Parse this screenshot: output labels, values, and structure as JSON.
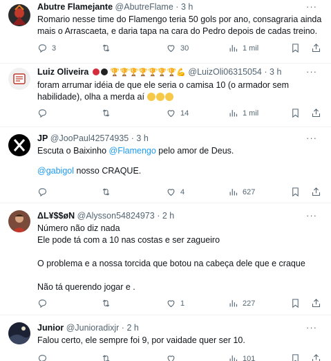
{
  "tweets": [
    {
      "name": "Abutre Flamejante",
      "handle": "@AbutreFlame",
      "time": "3 h",
      "text": "Romario nesse time do Flamengo teria 50 gols por ano, consagraria ainda mais o Arrascaeta, e daria tapa na cara do Pedro depois de cadas treino.",
      "replies": "3",
      "retweets": "",
      "likes": "30",
      "views": "1 mil"
    },
    {
      "name": "Luiz Oliveira",
      "name_suffix": "🏆🏆🏆🏆🏆🏆🏆💪",
      "handle": "@LuizOli06315054",
      "time": "3 h",
      "text": "foram arrumar idéia de que ele seria o camisa 10 (o armador sem habilidade), olha a merda aí",
      "replies": "",
      "retweets": "",
      "likes": "14",
      "views": "1 mil"
    },
    {
      "name": "JP",
      "handle": "@JooPaul42574935",
      "time": "3 h",
      "text_a": "Escuta o Baixinho ",
      "mention_a": "@Flamengo",
      "text_b": " pelo amor de Deus.",
      "mention_b": "@gabigol",
      "text_c": " nosso CRAQUE.",
      "replies": "",
      "retweets": "",
      "likes": "4",
      "views": "627"
    },
    {
      "name": "ΔL¥$$øN",
      "handle": "@Alysson54824973",
      "time": "2 h",
      "text": "Número não diz nada\nEle pode tá com a 10 nas costas e ser zagueiro\n\nO problema e a nossa torcida que botou na cabeça dele que e craque\n\nNão tá querendo jogar e .",
      "replies": "",
      "retweets": "",
      "likes": "1",
      "views": "227"
    },
    {
      "name": "Junior",
      "handle": "@Junioradixjr",
      "time": "2 h",
      "text": "Falou certo, ele sempre foi 9, por vaidade quer ser 10.",
      "replies": "",
      "retweets": "",
      "likes": "",
      "views": "101"
    }
  ],
  "separator": "·",
  "more": "···",
  "colors": {
    "accent": "#1d9bf0",
    "muted": "#536471",
    "text": "#0f1419"
  }
}
